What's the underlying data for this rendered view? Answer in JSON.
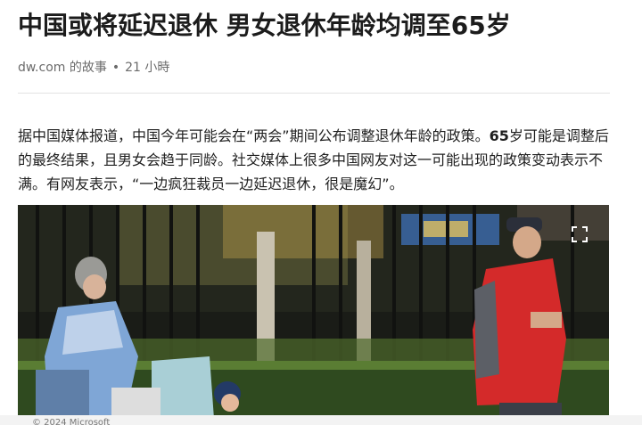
{
  "article": {
    "headline": "中国或将延迟退休 男女退休年龄均调至65岁",
    "source": "dw.com 的故事",
    "separator": "•",
    "time_ago": "21 小時",
    "body_part1": "据中国媒体报道，中国今年可能会在“两会”期间公布调整退休年龄的政策。",
    "body_bold": "65",
    "body_part2": "岁可能是调整后的最终结果，且男女会趋于同龄。社交媒体上很多中国网友对这一可能出现的政策变动表示不满。有网友表示，“一边疯狂裁员一边延迟退休，很是魔幻”。"
  },
  "photo": {
    "expand_icon": "expand-icon"
  },
  "footer": {
    "copyright": "© 2024 Microsoft"
  }
}
